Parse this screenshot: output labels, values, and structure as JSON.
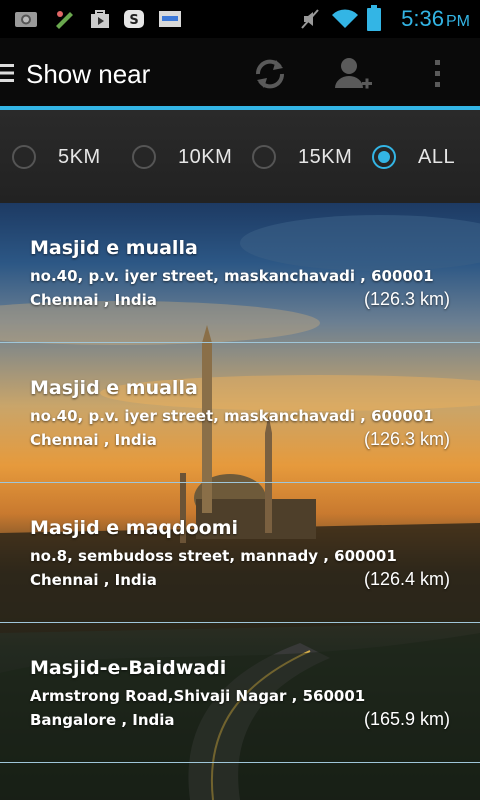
{
  "status_bar": {
    "time": "5:36",
    "ampm": "PM",
    "icons": [
      "gallery-icon",
      "app-icon",
      "play-store-icon",
      "skype-icon",
      "news-icon",
      "mute-icon",
      "wifi-icon",
      "battery-icon"
    ],
    "accent": "#33b5e5"
  },
  "action_bar": {
    "title": "Show near",
    "icons": [
      "menu-icon",
      "refresh-icon",
      "add-person-icon",
      "overflow-menu-icon"
    ]
  },
  "distance_filter": {
    "options": [
      "5KM",
      "10KM",
      "15KM",
      "ALL"
    ],
    "selected": "ALL"
  },
  "results": [
    {
      "name": "Masjid e mualla",
      "address": "no.40, p.v. iyer street, maskanchavadi , 600001",
      "city": "Chennai , India",
      "distance": "(126.3 km)"
    },
    {
      "name": "Masjid e mualla",
      "address": "no.40, p.v. iyer street, maskanchavadi , 600001",
      "city": "Chennai , India",
      "distance": "(126.3 km)"
    },
    {
      "name": "Masjid e maqdoomi",
      "address": "no.8, sembudoss street, mannady , 600001",
      "city": "Chennai , India",
      "distance": "(126.4 km)"
    },
    {
      "name": "Masjid-e-Baidwadi",
      "address": "Armstrong Road,Shivaji Nagar , 560001",
      "city": "Bangalore , India",
      "distance": "(165.9 km)"
    }
  ]
}
